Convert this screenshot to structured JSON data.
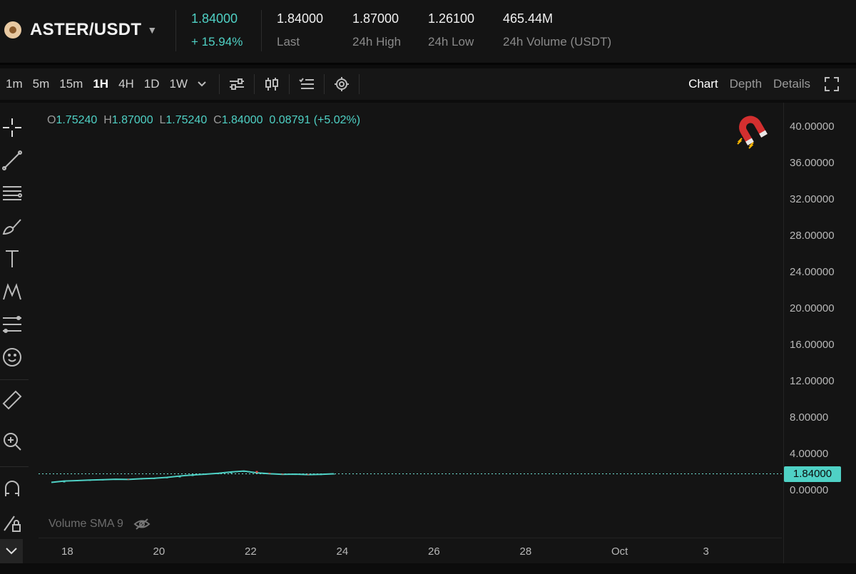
{
  "header": {
    "pair": "ASTER/USDT",
    "price": "1.84000",
    "change": "+ 15.94%",
    "stats": [
      {
        "value": "1.84000",
        "label": "Last"
      },
      {
        "value": "1.87000",
        "label": "24h High"
      },
      {
        "value": "1.26100",
        "label": "24h Low"
      },
      {
        "value": "465.44M",
        "label": "24h Volume (USDT)"
      }
    ]
  },
  "toolbar": {
    "timeframes": [
      "1m",
      "5m",
      "15m",
      "1H",
      "4H",
      "1D",
      "1W"
    ],
    "active_timeframe": "1H",
    "tabs": [
      "Chart",
      "Depth",
      "Details"
    ],
    "active_tab": "Chart"
  },
  "legend": {
    "o_key": "O",
    "o_val": "1.75240",
    "h_key": "H",
    "h_val": "1.87000",
    "l_key": "L",
    "l_val": "1.75240",
    "c_key": "C",
    "c_val": "1.84000",
    "change": "0.08791 (+5.02%)"
  },
  "volume_indicator": "Volume SMA 9",
  "colors": {
    "accent": "#4fd1c5",
    "background": "#141414",
    "magnet_red": "#d32f2f"
  },
  "chart_data": {
    "type": "line",
    "y_ticks": [
      "40.00000",
      "36.00000",
      "32.00000",
      "28.00000",
      "24.00000",
      "20.00000",
      "16.00000",
      "12.00000",
      "8.00000",
      "4.00000",
      "0.00000"
    ],
    "ylim": [
      0,
      40
    ],
    "x_ticks": [
      "18",
      "20",
      "22",
      "24",
      "26",
      "28",
      "Oct",
      "3"
    ],
    "current_price": 1.84,
    "current_price_label": "1.84000",
    "series": [
      {
        "x": [
          0,
          6,
          12,
          18,
          24,
          30,
          36,
          42,
          48,
          54,
          60,
          66,
          72,
          78,
          84,
          90,
          96,
          102,
          108,
          114,
          120,
          126,
          132
        ],
        "values": [
          0.9,
          1.05,
          1.1,
          1.15,
          1.2,
          1.25,
          1.22,
          1.3,
          1.35,
          1.45,
          1.6,
          1.72,
          1.8,
          1.9,
          2.05,
          2.15,
          1.95,
          1.85,
          1.78,
          1.8,
          1.76,
          1.79,
          1.84
        ]
      }
    ]
  }
}
